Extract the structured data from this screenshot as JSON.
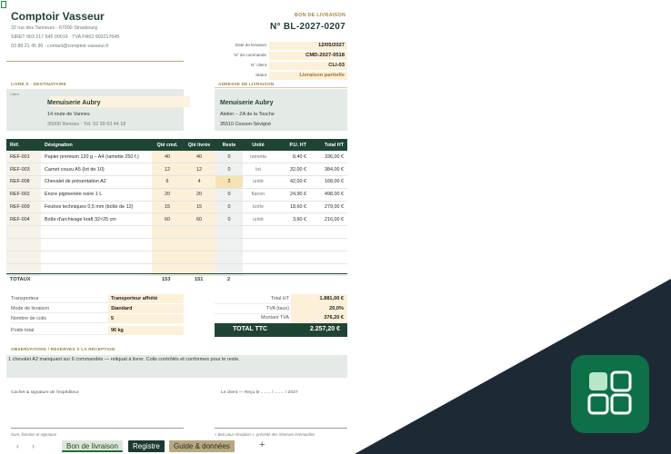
{
  "company": {
    "name": "Comptoir Vasseur",
    "address": "32 rue des Tanneurs · 67000 Strasbourg",
    "ids": "SIRET 903 217 645 00019 · TVA FR62 903217645",
    "contact": "03 88 21 45 90 · contact@comptoir-vasseur.fr"
  },
  "document": {
    "label": "BON DE LIVRAISON",
    "number": "N°  BL-2027-0207"
  },
  "meta": [
    {
      "label": "Date de livraison",
      "value": "12/05/2027"
    },
    {
      "label": "N° de commande",
      "value": "CMD-2027-0518"
    },
    {
      "label": "N° client",
      "value": "CLI-03"
    },
    {
      "label": "Statut",
      "value": "Livraison partielle"
    }
  ],
  "recipient": {
    "title": "LIVRÉ À · DESTINATAIRE",
    "client_label": "Client",
    "name": "Menuiserie Aubry",
    "street": "14 route de Vannes",
    "city_phone": "35000 Rennes   ·   Tél. 02 99 63 44 18"
  },
  "delivery_address": {
    "title": "ADRESSE DE LIVRAISON",
    "name": "Menuiserie Aubry",
    "line1": "Atelier – ZA de la Touche",
    "line2": "35510 Cesson-Sévigné"
  },
  "table": {
    "headers": [
      "Réf.",
      "Désignation",
      "Qté cmd.",
      "Qté livrée",
      "Reste",
      "Unité",
      "P.U. HT",
      "Total HT"
    ],
    "rows": [
      {
        "ref": "REF-001",
        "desc": "Papier premium 120 g – A4 (ramette 250 f.)",
        "qc": "40",
        "ql": "40",
        "rest": "0",
        "unit": "ramette",
        "pu": "8,40 €",
        "total": "336,00 €"
      },
      {
        "ref": "REF-003",
        "desc": "Carnet cousu A5 (lot de 10)",
        "qc": "12",
        "ql": "12",
        "rest": "0",
        "unit": "lot",
        "pu": "32,00 €",
        "total": "384,00 €"
      },
      {
        "ref": "REF-008",
        "desc": "Chevalet de présentation A2",
        "qc": "6",
        "ql": "4",
        "rest": "2",
        "unit": "unité",
        "pu": "42,00 €",
        "total": "168,00 €"
      },
      {
        "ref": "REF-002",
        "desc": "Encre pigmentée noire 1 L",
        "qc": "20",
        "ql": "20",
        "rest": "0",
        "unit": "flacon",
        "pu": "24,90 €",
        "total": "498,00 €"
      },
      {
        "ref": "REF-009",
        "desc": "Feutres techniques 0,5 mm (boîte de 12)",
        "qc": "15",
        "ql": "15",
        "rest": "0",
        "unit": "boîte",
        "pu": "18,60 €",
        "total": "279,00 €"
      },
      {
        "ref": "REF-004",
        "desc": "Boîte d'archivage kraft 32×25 cm",
        "qc": "60",
        "ql": "60",
        "rest": "0",
        "unit": "unité",
        "pu": "3,60 €",
        "total": "216,00 €"
      }
    ],
    "empty_rows": 4
  },
  "totals": {
    "label": "TOTAUX",
    "qc": "153",
    "ql": "151",
    "rest": "2"
  },
  "shipping": [
    {
      "label": "Transporteur",
      "value": "Transporteur affrété"
    },
    {
      "label": "Mode de livraison",
      "value": "Standard"
    },
    {
      "label": "Nombre de colis",
      "value": "5"
    },
    {
      "label": "Poids total",
      "value": "96 kg"
    }
  ],
  "summary": [
    {
      "label": "Total HT",
      "value": "1.881,00 €"
    },
    {
      "label": "TVA (taux)",
      "value": "20,0%"
    },
    {
      "label": "Montant TVA",
      "value": "376,20 €"
    }
  ],
  "ttc": {
    "label": "TOTAL TTC",
    "value": "2.257,20 €"
  },
  "observations": {
    "title": "OBSERVATIONS / RÉSERVES À LA RÉCEPTION",
    "text": "1 chevalet A2 manquant sur 6 commandés — reliquat à livrer. Colis contrôlés et conformes pour le reste."
  },
  "signatures": {
    "sender": "Cachet & signature de l'expéditeur",
    "receiver": "Le client — Reçu le ........ / ........ / 2027",
    "sender_caption": "Nom, fonction et signature",
    "receiver_caption": "« Bon pour réception », précédé des réserves éventuelles"
  },
  "tabs": {
    "active": "Bon de livraison",
    "second": "Registre",
    "third": "Guide & données",
    "add": "+",
    "prev": "‹",
    "next": "›"
  },
  "colors": {
    "brand_green": "#1e4434",
    "cream": "#fcf0d9",
    "gold": "#a88a44",
    "backdrop": "#1d2a35",
    "app_icon": "#0e7048"
  },
  "icons": {
    "app": "grid-app-icon"
  }
}
